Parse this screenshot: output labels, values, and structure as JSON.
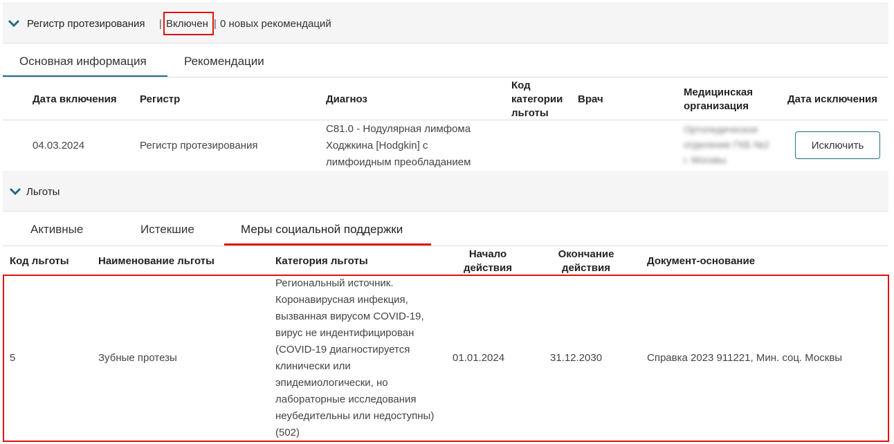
{
  "registry": {
    "title": "Регистр протезирования",
    "sep1": "|",
    "status": "Включен",
    "sep2": "|",
    "recommendations": "0 новых рекомендаций"
  },
  "main_tabs": [
    {
      "label": "Основная информация",
      "active": true
    },
    {
      "label": "Рекомендации",
      "active": false
    }
  ],
  "registry_table": {
    "headers": {
      "date_in": "Дата включения",
      "register": "Регистр",
      "diagnosis": "Диагноз",
      "code": "Код категории льготы",
      "doctor": "Врач",
      "org": "Медицинская организация",
      "date_out": "Дата исключения"
    },
    "row": {
      "date_in": "04.03.2024",
      "register": "Регистр протезирования",
      "diagnosis": "С81.0 - Нодулярная лимфома Ходжкина [Hodgkin] с лимфоидным преобладанием",
      "org_blurred": "Ортопедическое отделение ГКБ №2 г. Москвы",
      "exclude_button": "Исключить"
    }
  },
  "benefits": {
    "title": "Льготы",
    "tabs": [
      {
        "label": "Активные",
        "active": false
      },
      {
        "label": "Истекшие",
        "active": false
      },
      {
        "label": "Меры социальной поддержки",
        "active": true
      }
    ],
    "headers": {
      "code": "Код льготы",
      "name": "Наименование льготы",
      "category": "Категория льготы",
      "start": "Начало действия",
      "end": "Окончание действия",
      "doc": "Документ-основание"
    },
    "row": {
      "code": "5",
      "name": "Зубные протезы",
      "category": "Региональный источник. Коронавирусная инфекция, вызванная вирусом COVID-19, вирус не индентифицирован (COVID-19 диагностируется клинически или эпидемиологически, но лабораторные исследования неубедительны или недоступны) (502)",
      "start": "01.01.2024",
      "end": "31.12.2030",
      "doc": "Справка 2023 911221, Мин. соц. Москвы"
    }
  },
  "colors": {
    "accent": "#1e6d86",
    "highlight": "#e01010"
  }
}
